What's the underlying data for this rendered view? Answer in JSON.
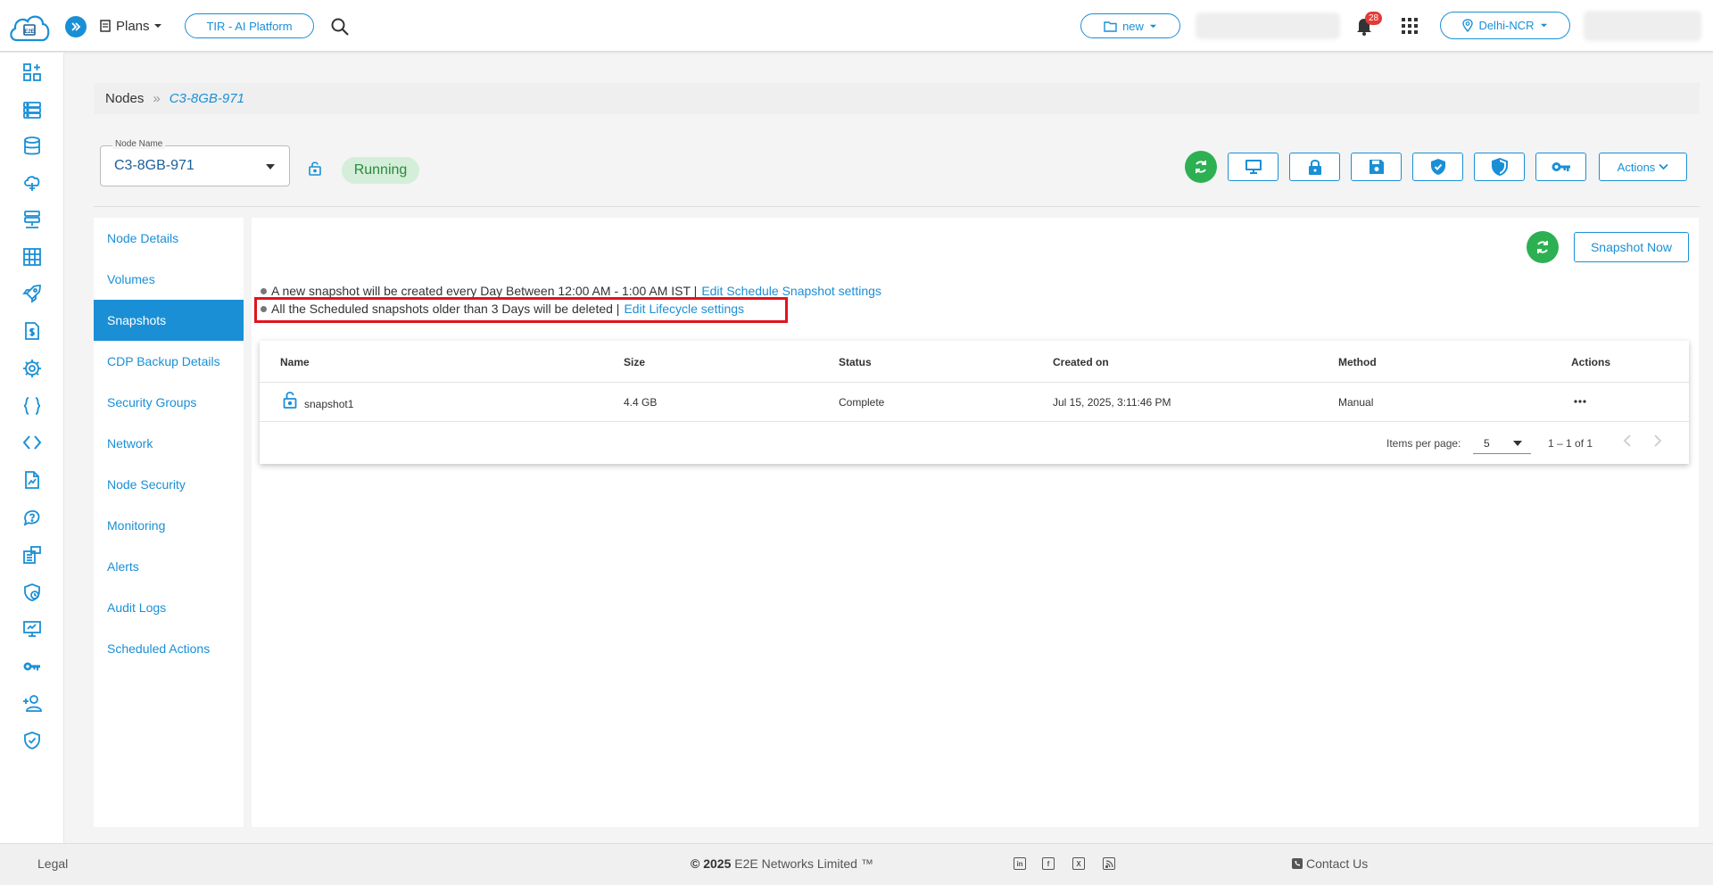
{
  "header": {
    "logo_text": "E2E",
    "plans_label": "Plans",
    "platform_label": "TIR - AI Platform",
    "project_label": "new",
    "notification_count": "28",
    "region_label": "Delhi-NCR"
  },
  "breadcrumb": {
    "root": "Nodes",
    "separator": "»",
    "current": "C3-8GB-971"
  },
  "node": {
    "field_label": "Node Name",
    "name": "C3-8GB-971",
    "status": "Running",
    "actions_label": "Actions"
  },
  "subnav": {
    "items": [
      "Node Details",
      "Volumes",
      "Snapshots",
      "CDP Backup Details",
      "Security Groups",
      "Network",
      "Node Security",
      "Monitoring",
      "Alerts",
      "Audit Logs",
      "Scheduled Actions"
    ],
    "active": "Snapshots"
  },
  "snapshots": {
    "snapshot_now_label": "Snapshot Now",
    "schedule_text": "A new snapshot will be created every Day Between 12:00 AM - 1:00 AM IST |",
    "schedule_link": "Edit Schedule Snapshot settings",
    "lifecycle_text": "All the Scheduled snapshots older than 3 Days will be deleted |",
    "lifecycle_link": "Edit Lifecycle settings",
    "columns": [
      "Name",
      "Size",
      "Status",
      "Created on",
      "Method",
      "Actions"
    ],
    "rows": [
      {
        "name": "snapshot1",
        "size": "4.4 GB",
        "status": "Complete",
        "created_on": "Jul 15, 2025, 3:11:46 PM",
        "method": "Manual"
      }
    ],
    "pagination": {
      "items_per_page_label": "Items per page:",
      "items_per_page": "5",
      "range": "1 – 1 of 1"
    }
  },
  "footer": {
    "legal": "Legal",
    "copyright_prefix": "© 2025",
    "copyright_rest": "E2E Networks Limited ™",
    "contact": "Contact Us"
  },
  "colors": {
    "primary": "#1a8fd6",
    "success": "#2db052",
    "highlight": "#e0141e",
    "running_bg": "#d4eed9"
  }
}
